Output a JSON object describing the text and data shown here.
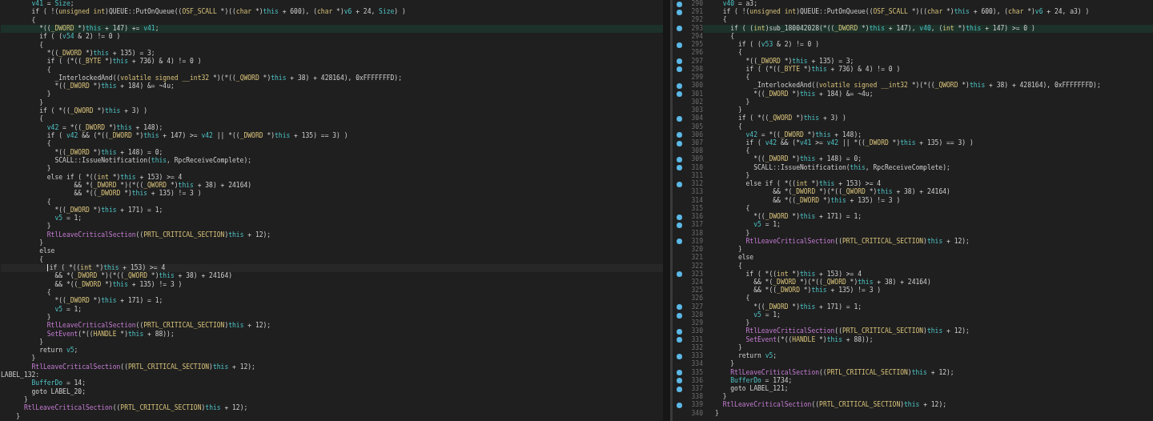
{
  "left_pane": {
    "lines": [
      {
        "text": "        v41 = Size;",
        "highlighted": false,
        "cursor": false
      },
      {
        "text": "        if ( !(unsigned int)QUEUE::PutOnQueue((OSF_SCALL *)((char *)this + 600), (char *)v6 + 24, Size) )",
        "highlighted": false,
        "cursor": false
      },
      {
        "text": "        {",
        "highlighted": false,
        "cursor": false
      },
      {
        "text": "          *((_DWORD *)this + 147) += v41;",
        "highlighted": true,
        "cursor": false
      },
      {
        "text": "          if ( (v54 & 2) != 0 )",
        "highlighted": false,
        "cursor": false
      },
      {
        "text": "          {",
        "highlighted": false,
        "cursor": false
      },
      {
        "text": "            *((_DWORD *)this + 135) = 3;",
        "highlighted": false,
        "cursor": false
      },
      {
        "text": "            if ( (*((_BYTE *)this + 736) & 4) != 0 )",
        "highlighted": false,
        "cursor": false
      },
      {
        "text": "            {",
        "highlighted": false,
        "cursor": false
      },
      {
        "text": "              _InterlockedAnd((volatile signed __int32 *)(*((_QWORD *)this + 38) + 428164), 0xFFFFFFFD);",
        "highlighted": false,
        "cursor": false
      },
      {
        "text": "              *((_DWORD *)this + 184) &= ~4u;",
        "highlighted": false,
        "cursor": false
      },
      {
        "text": "            }",
        "highlighted": false,
        "cursor": false
      },
      {
        "text": "          }",
        "highlighted": false,
        "cursor": false
      },
      {
        "text": "          if ( *((_QWORD *)this + 3) )",
        "highlighted": false,
        "cursor": false
      },
      {
        "text": "          {",
        "highlighted": false,
        "cursor": false
      },
      {
        "text": "            v42 = *((_DWORD *)this + 148);",
        "highlighted": false,
        "cursor": false
      },
      {
        "text": "            if ( v42 && (*((_DWORD *)this + 147) >= v42 || *((_DWORD *)this + 135) == 3) )",
        "highlighted": false,
        "cursor": false
      },
      {
        "text": "            {",
        "highlighted": false,
        "cursor": false
      },
      {
        "text": "              *((_DWORD *)this + 148) = 0;",
        "highlighted": false,
        "cursor": false
      },
      {
        "text": "              SCALL::IssueNotification(this, RpcReceiveComplete);",
        "highlighted": false,
        "cursor": false
      },
      {
        "text": "            }",
        "highlighted": false,
        "cursor": false
      },
      {
        "text": "            else if ( *((int *)this + 153) >= 4",
        "highlighted": false,
        "cursor": false
      },
      {
        "text": "                   && *(_DWORD *)(*((_QWORD *)this + 38) + 24164)",
        "highlighted": false,
        "cursor": false
      },
      {
        "text": "                   && *((_DWORD *)this + 135) != 3 )",
        "highlighted": false,
        "cursor": false
      },
      {
        "text": "            {",
        "highlighted": false,
        "cursor": false
      },
      {
        "text": "              *((_DWORD *)this + 171) = 1;",
        "highlighted": false,
        "cursor": false
      },
      {
        "text": "              v5 = 1;",
        "highlighted": false,
        "cursor": false
      },
      {
        "text": "            }",
        "highlighted": false,
        "cursor": false
      },
      {
        "text": "            RtlLeaveCriticalSection((PRTL_CRITICAL_SECTION)this + 12);",
        "highlighted": false,
        "cursor": false
      },
      {
        "text": "          }",
        "highlighted": false,
        "cursor": false
      },
      {
        "text": "          else",
        "highlighted": false,
        "cursor": false
      },
      {
        "text": "          {",
        "highlighted": false,
        "cursor": false
      },
      {
        "text": "            if ( *((int *)this + 153) >= 4",
        "highlighted": false,
        "cursor": true
      },
      {
        "text": "              && *(_DWORD *)(*((_QWORD *)this + 38) + 24164)",
        "highlighted": false,
        "cursor": false
      },
      {
        "text": "              && *((_DWORD *)this + 135) != 3 )",
        "highlighted": false,
        "cursor": false
      },
      {
        "text": "            {",
        "highlighted": false,
        "cursor": false
      },
      {
        "text": "              *((_DWORD *)this + 171) = 1;",
        "highlighted": false,
        "cursor": false
      },
      {
        "text": "              v5 = 1;",
        "highlighted": false,
        "cursor": false
      },
      {
        "text": "            }",
        "highlighted": false,
        "cursor": false
      },
      {
        "text": "            RtlLeaveCriticalSection((PRTL_CRITICAL_SECTION)this + 12);",
        "highlighted": false,
        "cursor": false
      },
      {
        "text": "            SetEvent(*((HANDLE *)this + 88));",
        "highlighted": false,
        "cursor": false
      },
      {
        "text": "          }",
        "highlighted": false,
        "cursor": false
      },
      {
        "text": "          return v5;",
        "highlighted": false,
        "cursor": false
      },
      {
        "text": "        }",
        "highlighted": false,
        "cursor": false
      },
      {
        "text": "        RtlLeaveCriticalSection((PRTL_CRITICAL_SECTION)this + 12);",
        "highlighted": false,
        "cursor": false
      },
      {
        "text": "LABEL_132:",
        "highlighted": false,
        "cursor": false
      },
      {
        "text": "        BufferDo = 14;",
        "highlighted": false,
        "cursor": false
      },
      {
        "text": "        goto LABEL_20;",
        "highlighted": false,
        "cursor": false
      },
      {
        "text": "      }",
        "highlighted": false,
        "cursor": false
      },
      {
        "text": "      RtlLeaveCriticalSection((PRTL_CRITICAL_SECTION)this + 12);",
        "highlighted": false,
        "cursor": false
      },
      {
        "text": "    }",
        "highlighted": false,
        "cursor": false
      }
    ]
  },
  "right_pane": {
    "lines": [
      {
        "number": "290",
        "breakpoint": true,
        "text": "  v40 = a3;",
        "highlighted": false
      },
      {
        "number": "291",
        "breakpoint": true,
        "text": "  if ( !(unsigned int)QUEUE::PutOnQueue((OSF_SCALL *)((char *)this + 600), (char *)v6 + 24, a3) )",
        "highlighted": false
      },
      {
        "number": "292",
        "breakpoint": false,
        "text": "  {",
        "highlighted": false
      },
      {
        "number": "293",
        "breakpoint": true,
        "text": "    if ( (int)sub_180042028(*((_DWORD *)this + 147), v40, (int *)this + 147) >= 0 )",
        "highlighted": true
      },
      {
        "number": "294",
        "breakpoint": false,
        "text": "    {",
        "highlighted": false
      },
      {
        "number": "295",
        "breakpoint": true,
        "text": "      if ( (v53 & 2) != 0 )",
        "highlighted": false
      },
      {
        "number": "296",
        "breakpoint": false,
        "text": "      {",
        "highlighted": false
      },
      {
        "number": "297",
        "breakpoint": true,
        "text": "        *((_DWORD *)this + 135) = 3;",
        "highlighted": false
      },
      {
        "number": "298",
        "breakpoint": true,
        "text": "        if ( (*((_BYTE *)this + 736) & 4) != 0 )",
        "highlighted": false
      },
      {
        "number": "299",
        "breakpoint": false,
        "text": "        {",
        "highlighted": false
      },
      {
        "number": "300",
        "breakpoint": true,
        "text": "          _InterlockedAnd((volatile signed __int32 *)(*((_QWORD *)this + 38) + 428164), 0xFFFFFFFD);",
        "highlighted": false
      },
      {
        "number": "301",
        "breakpoint": true,
        "text": "          *((_DWORD *)this + 184) &= ~4u;",
        "highlighted": false
      },
      {
        "number": "302",
        "breakpoint": false,
        "text": "        }",
        "highlighted": false
      },
      {
        "number": "303",
        "breakpoint": false,
        "text": "      }",
        "highlighted": false
      },
      {
        "number": "304",
        "breakpoint": true,
        "text": "      if ( *((_QWORD *)this + 3) )",
        "highlighted": false
      },
      {
        "number": "305",
        "breakpoint": false,
        "text": "      {",
        "highlighted": false
      },
      {
        "number": "306",
        "breakpoint": true,
        "text": "        v42 = *((_DWORD *)this + 148);",
        "highlighted": false
      },
      {
        "number": "307",
        "breakpoint": true,
        "text": "        if ( v42 && (*v41 >= v42 || *((_DWORD *)this + 135) == 3) )",
        "highlighted": false
      },
      {
        "number": "308",
        "breakpoint": false,
        "text": "        {",
        "highlighted": false
      },
      {
        "number": "309",
        "breakpoint": true,
        "text": "          *((_DWORD *)this + 148) = 0;",
        "highlighted": false
      },
      {
        "number": "310",
        "breakpoint": true,
        "text": "          SCALL::IssueNotification(this, RpcReceiveComplete);",
        "highlighted": false
      },
      {
        "number": "311",
        "breakpoint": false,
        "text": "        }",
        "highlighted": false
      },
      {
        "number": "312",
        "breakpoint": true,
        "text": "        else if ( *((int *)this + 153) >= 4",
        "highlighted": false
      },
      {
        "number": "313",
        "breakpoint": false,
        "text": "               && *(_DWORD *)(*((_QWORD *)this + 38) + 24164)",
        "highlighted": false
      },
      {
        "number": "314",
        "breakpoint": false,
        "text": "               && *((_DWORD *)this + 135) != 3 )",
        "highlighted": false
      },
      {
        "number": "315",
        "breakpoint": false,
        "text": "        {",
        "highlighted": false
      },
      {
        "number": "316",
        "breakpoint": true,
        "text": "          *((_DWORD *)this + 171) = 1;",
        "highlighted": false
      },
      {
        "number": "317",
        "breakpoint": true,
        "text": "          v5 = 1;",
        "highlighted": false
      },
      {
        "number": "318",
        "breakpoint": false,
        "text": "        }",
        "highlighted": false
      },
      {
        "number": "319",
        "breakpoint": true,
        "text": "        RtlLeaveCriticalSection((PRTL_CRITICAL_SECTION)this + 12);",
        "highlighted": false
      },
      {
        "number": "320",
        "breakpoint": false,
        "text": "      }",
        "highlighted": false
      },
      {
        "number": "321",
        "breakpoint": false,
        "text": "      else",
        "highlighted": false
      },
      {
        "number": "322",
        "breakpoint": false,
        "text": "      {",
        "highlighted": false
      },
      {
        "number": "323",
        "breakpoint": true,
        "text": "        if ( *((int *)this + 153) >= 4",
        "highlighted": false
      },
      {
        "number": "324",
        "breakpoint": false,
        "text": "          && *(_DWORD *)(*((_QWORD *)this + 38) + 24164)",
        "highlighted": false
      },
      {
        "number": "325",
        "breakpoint": false,
        "text": "          && *((_DWORD *)this + 135) != 3 )",
        "highlighted": false
      },
      {
        "number": "326",
        "breakpoint": false,
        "text": "        {",
        "highlighted": false
      },
      {
        "number": "327",
        "breakpoint": true,
        "text": "          *((_DWORD *)this + 171) = 1;",
        "highlighted": false
      },
      {
        "number": "328",
        "breakpoint": true,
        "text": "          v5 = 1;",
        "highlighted": false
      },
      {
        "number": "329",
        "breakpoint": false,
        "text": "        }",
        "highlighted": false
      },
      {
        "number": "330",
        "breakpoint": true,
        "text": "        RtlLeaveCriticalSection((PRTL_CRITICAL_SECTION)this + 12);",
        "highlighted": false
      },
      {
        "number": "331",
        "breakpoint": true,
        "text": "        SetEvent(*((HANDLE *)this + 88));",
        "highlighted": false
      },
      {
        "number": "332",
        "breakpoint": false,
        "text": "      }",
        "highlighted": false
      },
      {
        "number": "333",
        "breakpoint": true,
        "text": "      return v5;",
        "highlighted": false
      },
      {
        "number": "334",
        "breakpoint": false,
        "text": "    }",
        "highlighted": false
      },
      {
        "number": "335",
        "breakpoint": true,
        "text": "    RtlLeaveCriticalSection((PRTL_CRITICAL_SECTION)this + 12);",
        "highlighted": false
      },
      {
        "number": "336",
        "breakpoint": true,
        "text": "    BufferDo = 1734;",
        "highlighted": false
      },
      {
        "number": "337",
        "breakpoint": true,
        "text": "    goto LABEL_121;",
        "highlighted": false
      },
      {
        "number": "338",
        "breakpoint": false,
        "text": "  }",
        "highlighted": false
      },
      {
        "number": "339",
        "breakpoint": true,
        "text": "  RtlLeaveCriticalSection((PRTL_CRITICAL_SECTION)this + 12);",
        "highlighted": false
      },
      {
        "number": "340",
        "breakpoint": false,
        "text": "}",
        "highlighted": false
      }
    ]
  }
}
